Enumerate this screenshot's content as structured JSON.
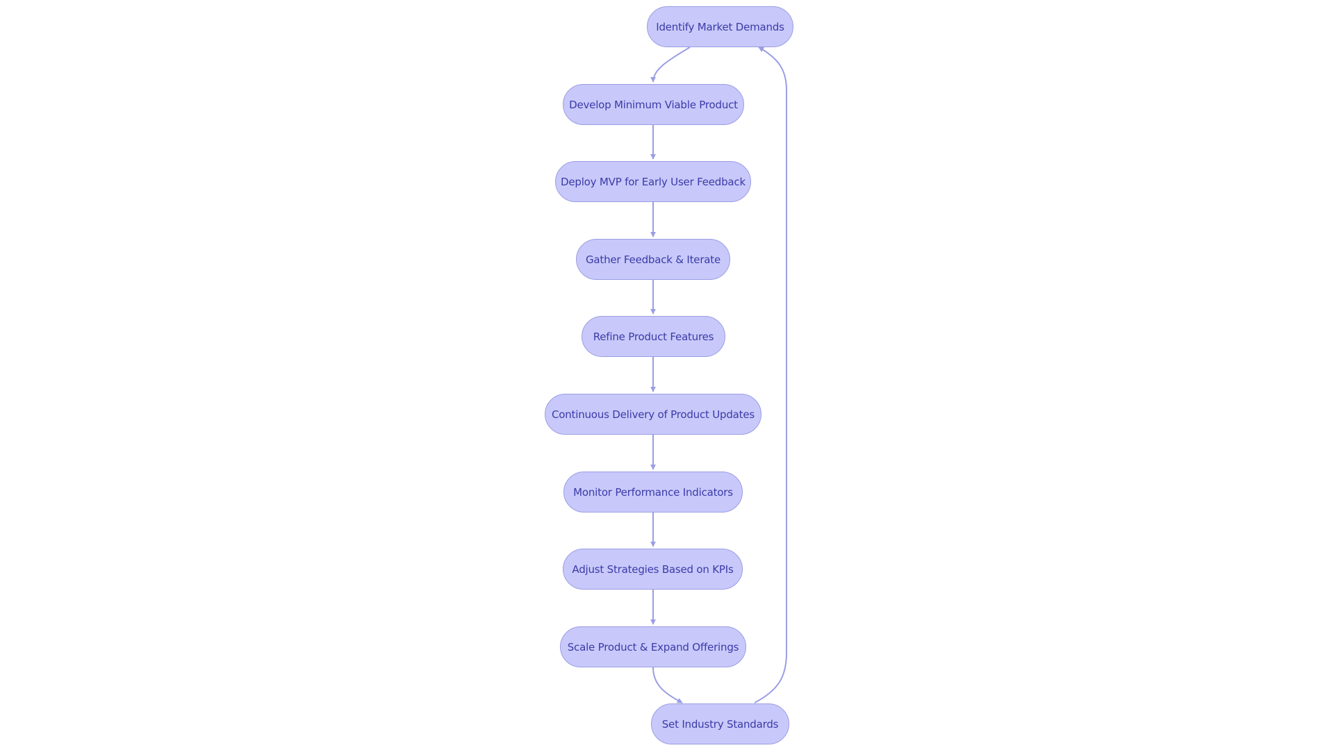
{
  "diagram": {
    "type": "flowchart",
    "direction": "top-to-bottom",
    "colors": {
      "node_fill": "#c8c9fa",
      "node_stroke": "#9a9de3",
      "node_text": "#3a3aa8",
      "edge": "#9a9de3"
    },
    "nodes": [
      {
        "id": "n1",
        "label": "Identify Market Demands"
      },
      {
        "id": "n2",
        "label": "Develop Minimum Viable Product"
      },
      {
        "id": "n3",
        "label": "Deploy MVP for Early User Feedback"
      },
      {
        "id": "n4",
        "label": "Gather Feedback & Iterate"
      },
      {
        "id": "n5",
        "label": "Refine Product Features"
      },
      {
        "id": "n6",
        "label": "Continuous Delivery of Product Updates"
      },
      {
        "id": "n7",
        "label": "Monitor Performance Indicators"
      },
      {
        "id": "n8",
        "label": "Adjust Strategies Based on KPIs"
      },
      {
        "id": "n9",
        "label": "Scale Product & Expand Offerings"
      },
      {
        "id": "n10",
        "label": "Set Industry Standards"
      }
    ],
    "edges": [
      {
        "from": "n1",
        "to": "n2"
      },
      {
        "from": "n2",
        "to": "n3"
      },
      {
        "from": "n3",
        "to": "n4"
      },
      {
        "from": "n4",
        "to": "n5"
      },
      {
        "from": "n5",
        "to": "n6"
      },
      {
        "from": "n6",
        "to": "n7"
      },
      {
        "from": "n7",
        "to": "n8"
      },
      {
        "from": "n8",
        "to": "n9"
      },
      {
        "from": "n9",
        "to": "n10"
      },
      {
        "from": "n10",
        "to": "n1"
      }
    ]
  }
}
